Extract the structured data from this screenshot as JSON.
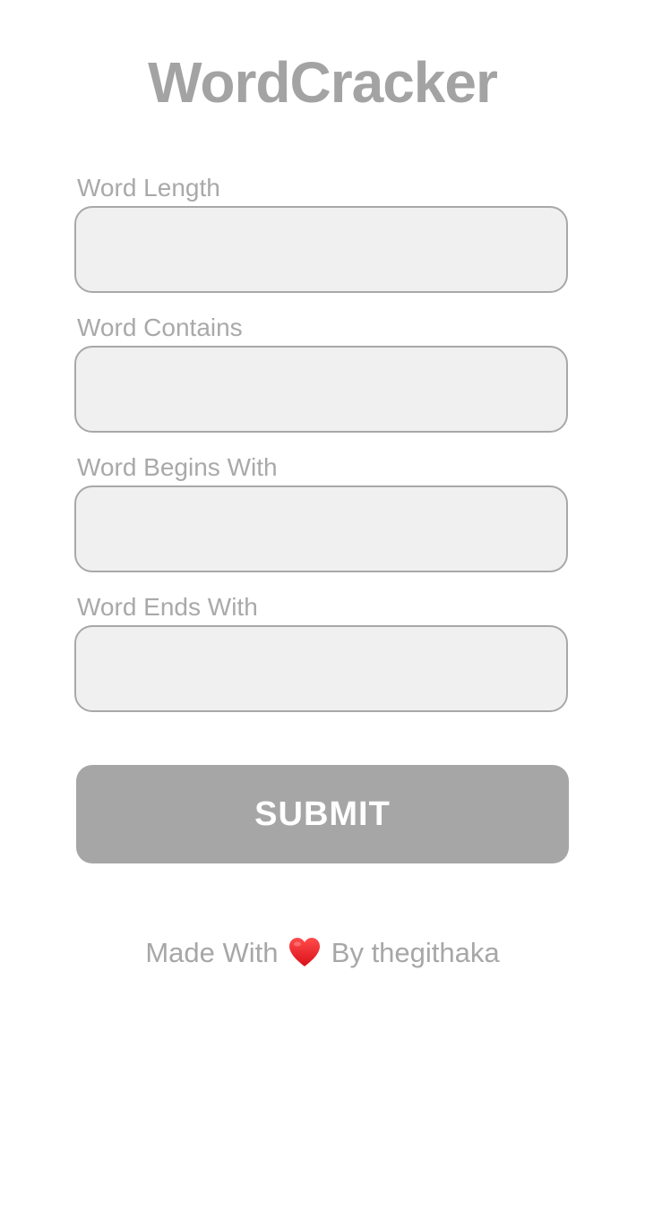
{
  "app": {
    "title": "WordCracker"
  },
  "form": {
    "fields": [
      {
        "label": "Word Length",
        "value": "",
        "placeholder": ""
      },
      {
        "label": "Word Contains",
        "value": "",
        "placeholder": ""
      },
      {
        "label": "Word Begins With",
        "value": "",
        "placeholder": ""
      },
      {
        "label": "Word Ends With",
        "value": "",
        "placeholder": ""
      }
    ],
    "submit_label": "SUBMIT"
  },
  "footer": {
    "prefix": "Made With",
    "icon": "heart-icon",
    "suffix": "By thegithaka"
  },
  "colors": {
    "text": "#a5a5a5",
    "input_background": "#f0f0f0",
    "input_border": "#a8a8a8",
    "button_background": "#a6a6a6",
    "heart": "#ee1c25"
  }
}
